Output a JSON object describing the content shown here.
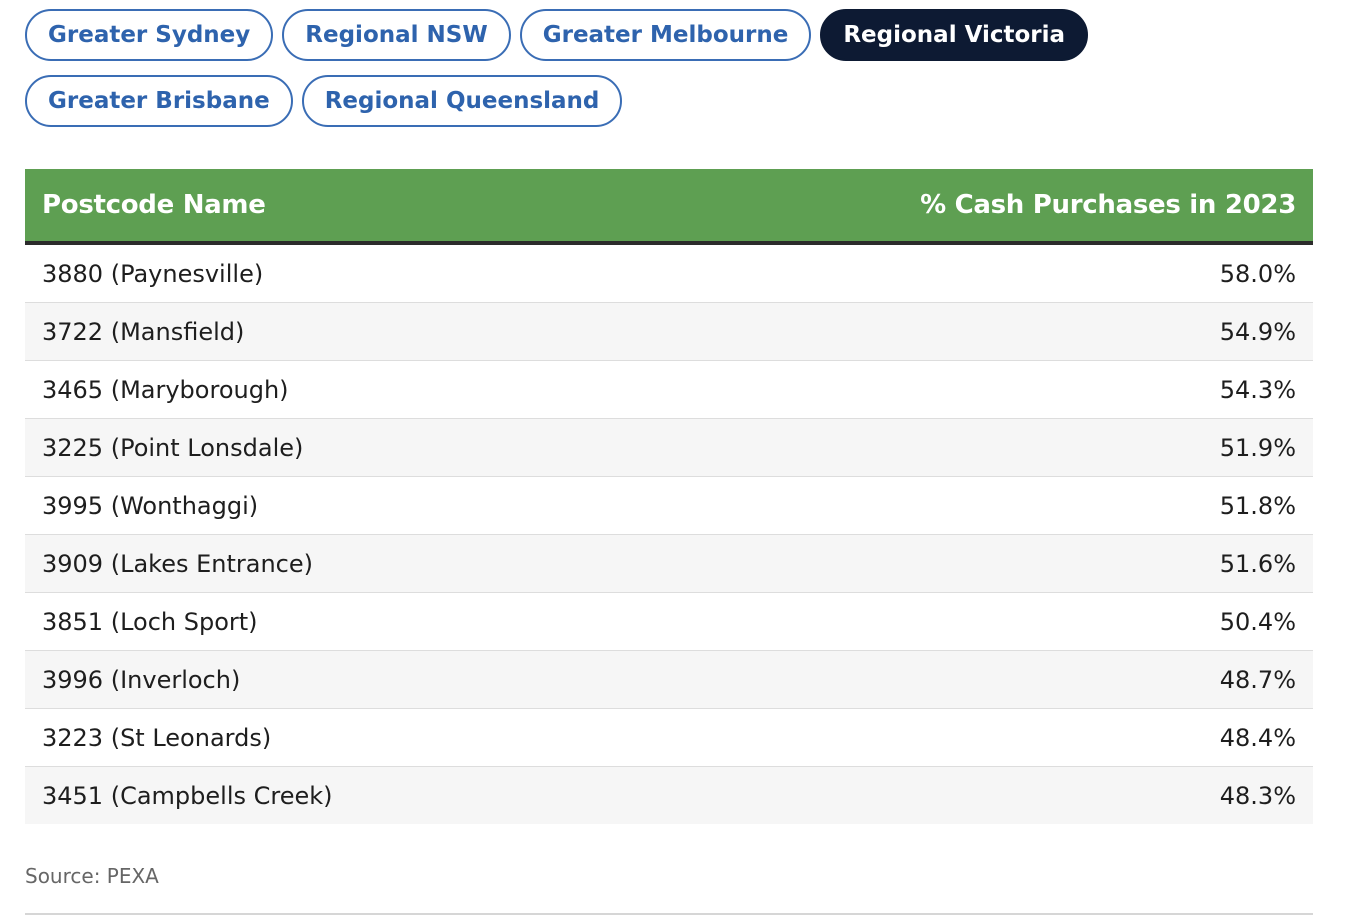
{
  "tabs": [
    {
      "label": "Greater Sydney",
      "active": false
    },
    {
      "label": "Regional NSW",
      "active": false
    },
    {
      "label": "Greater Melbourne",
      "active": false
    },
    {
      "label": "Regional Victoria",
      "active": true
    },
    {
      "label": "Greater Brisbane",
      "active": false
    },
    {
      "label": "Regional Queensland",
      "active": false
    }
  ],
  "table": {
    "headers": [
      "Postcode Name",
      "% Cash Purchases in 2023"
    ],
    "rows": [
      [
        "3880 (Paynesville)",
        "58.0%"
      ],
      [
        "3722 (Mansfield)",
        "54.9%"
      ],
      [
        "3465 (Maryborough)",
        "54.3%"
      ],
      [
        "3225 (Point Lonsdale)",
        "51.9%"
      ],
      [
        "3995 (Wonthaggi)",
        "51.8%"
      ],
      [
        "3909 (Lakes Entrance)",
        "51.6%"
      ],
      [
        "3851 (Loch Sport)",
        "50.4%"
      ],
      [
        "3996 (Inverloch)",
        "48.7%"
      ],
      [
        "3223 (St Leonards)",
        "48.4%"
      ],
      [
        "3451 (Campbells Creek)",
        "48.3%"
      ]
    ]
  },
  "source": "Source: PEXA",
  "colors": {
    "tab_text": "#2e63ad",
    "tab_active_bg": "#0d1a33",
    "header_bg": "#5e9f52"
  }
}
